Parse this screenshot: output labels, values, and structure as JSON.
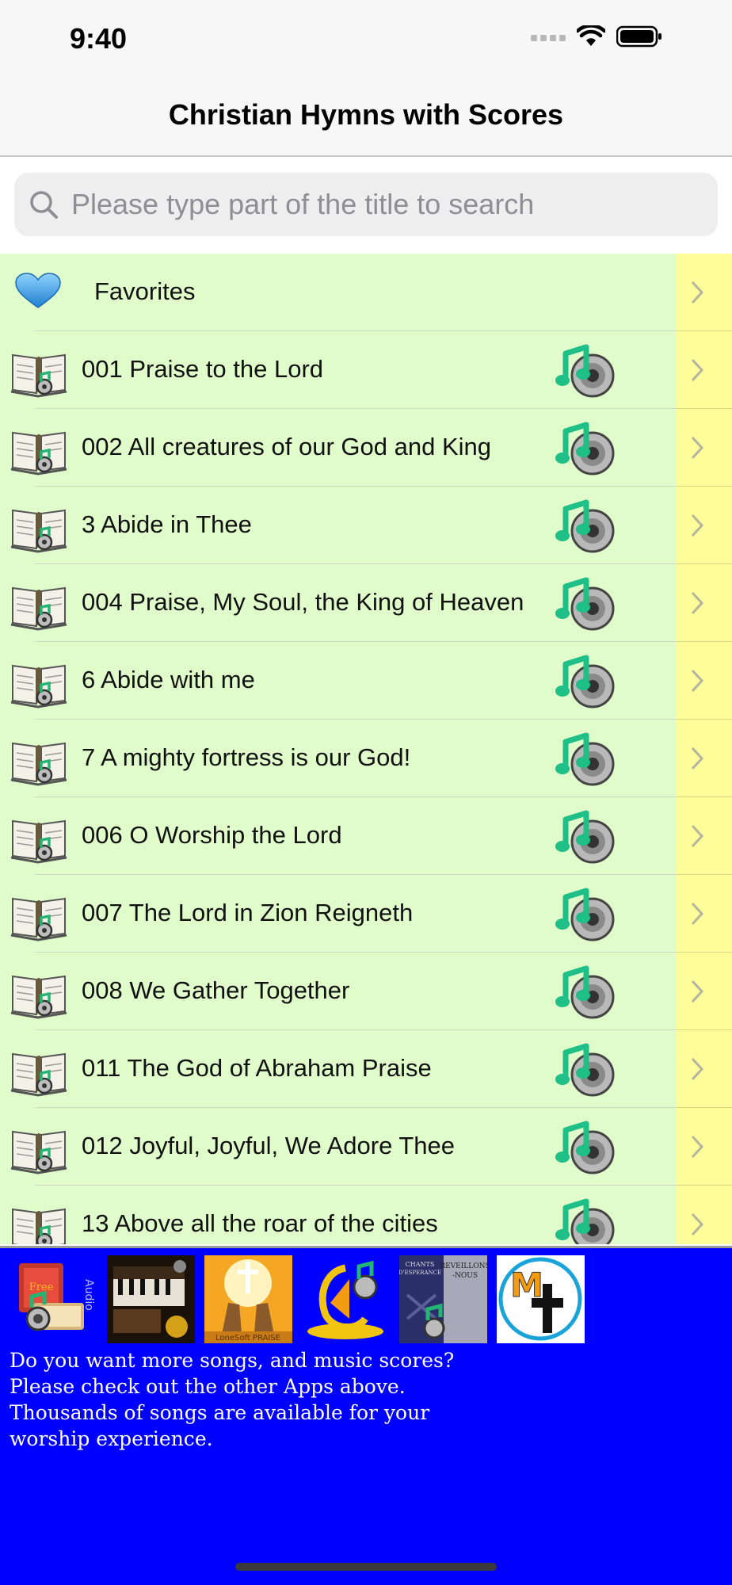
{
  "status": {
    "time": "9:40"
  },
  "nav": {
    "title": "Christian Hymns with Scores"
  },
  "search": {
    "placeholder": "Please type part of the title to search"
  },
  "favorites": {
    "label": "Favorites"
  },
  "hymns": [
    "001 Praise to the Lord",
    "002 All creatures of our God and King",
    "3 Abide in Thee",
    "004 Praise, My Soul, the King of Heaven",
    "6 Abide with me",
    "7 A mighty fortress is our God!",
    "006 O Worship the Lord",
    "007 The Lord in Zion Reigneth",
    "008 We Gather Together",
    "011 The God of Abraham Praise",
    "012 Joyful, Joyful, We Adore Thee",
    "13 Above all the roar of the cities"
  ],
  "promo": {
    "icons": [
      "audio-free-hymns-app-icon",
      "piano-hymns-app-icon",
      "praise-hands-app-icon",
      "adventist-hymns-app-icon",
      "chants-esperance-app-icon",
      "music-cross-app-icon"
    ],
    "text_lines": [
      "Do you want more songs, and music scores?",
      "Please check out the other Apps above.",
      "Thousands of songs are available for your",
      "worship experience."
    ],
    "colors": {
      "background": "#0000ff",
      "text": "#ffffff"
    }
  },
  "colors": {
    "list_bg": "#e1fccb",
    "accessory_bg": "#fdfd9a"
  }
}
